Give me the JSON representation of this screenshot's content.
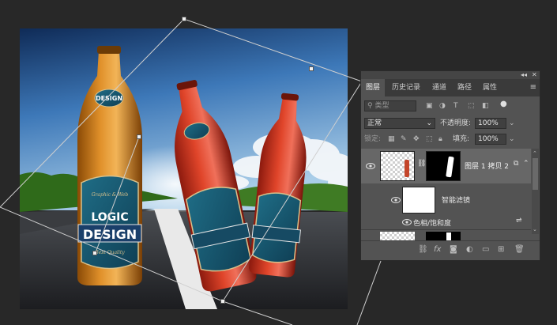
{
  "canvas": {
    "artwork_text": {
      "logo_line1": "LOGIC",
      "logo_line2": "DESIGN",
      "cap_badge": "DESIGN",
      "script_top": "Graphic & Web",
      "script_bottom": "Best Quality"
    }
  },
  "panel": {
    "collapse": "◂◂",
    "close": "✕",
    "tabs": [
      "图层",
      "历史记录",
      "通道",
      "路径",
      "属性"
    ],
    "filter_placeholder": "类型",
    "blend_mode": "正常",
    "opacity_label": "不透明度:",
    "opacity_value": "100%",
    "lock_label": "锁定:",
    "fill_label": "填充:",
    "fill_value": "100%",
    "layers": {
      "smart_layer_name": "图层 1 拷贝 2",
      "smart_filters_label": "智能滤镜",
      "filter_name": "色相/饱和度"
    },
    "bottom_icons": [
      "link-layers-icon",
      "fx-icon",
      "mask-icon",
      "adjustment-icon",
      "group-icon",
      "new-layer-icon",
      "delete-icon"
    ]
  },
  "colors": {
    "app_bg": "#282828",
    "panel_bg": "#535353",
    "tab_bar": "#3a3a3a",
    "selected_layer": "#676767"
  }
}
